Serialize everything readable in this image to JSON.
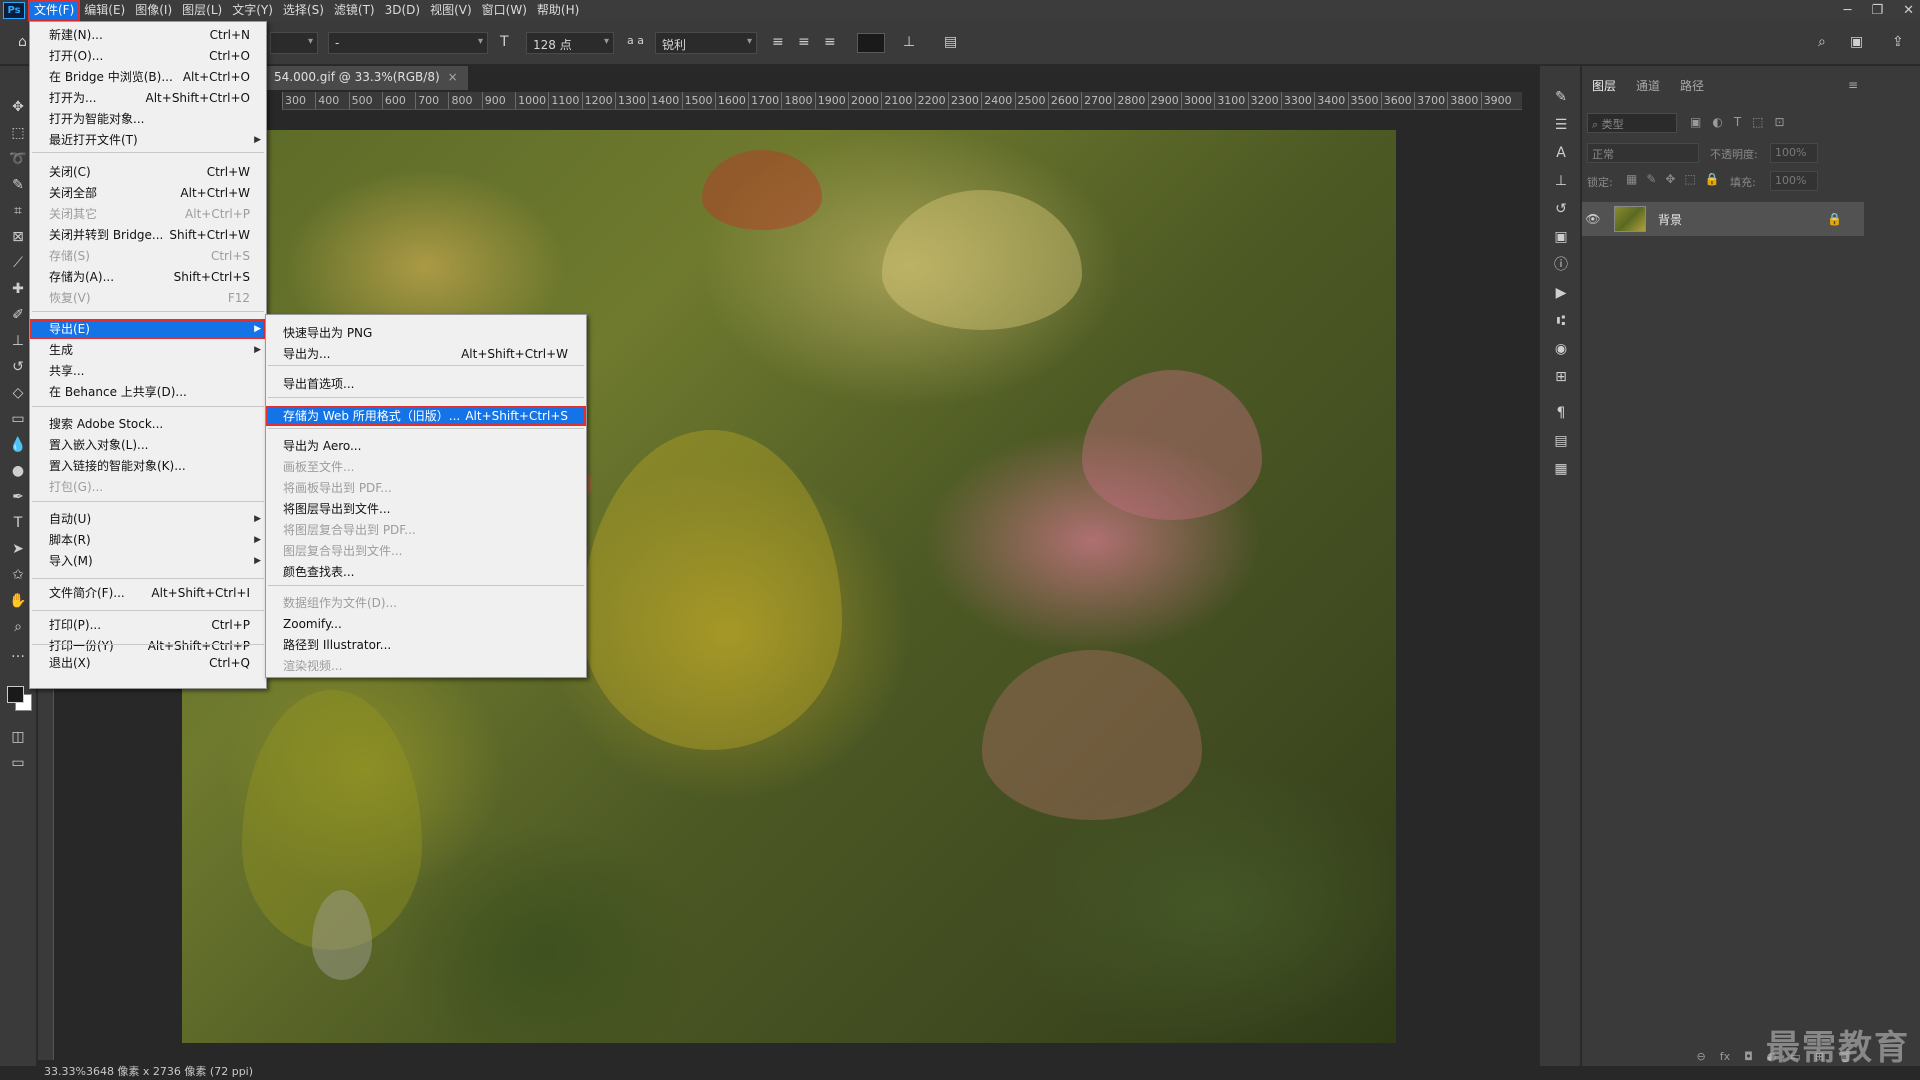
{
  "menubar": {
    "logo": "Ps",
    "items": [
      "文件(F)",
      "编辑(E)",
      "图像(I)",
      "图层(L)",
      "文字(Y)",
      "选择(S)",
      "滤镜(T)",
      "3D(D)",
      "视图(V)",
      "窗口(W)",
      "帮助(H)"
    ],
    "active_index": 0
  },
  "options": {
    "font_style": "-",
    "font_size": "128 点",
    "aa_label": "a a",
    "antialias": "锐利"
  },
  "document": {
    "tab_title": "54.000.gif @ 33.3%(RGB/8)",
    "ruler_ticks": [
      "300",
      "400",
      "500",
      "600",
      "700",
      "800",
      "900",
      "1000",
      "1100",
      "1200",
      "1300",
      "1400",
      "1500",
      "1600",
      "1700",
      "1800",
      "1900",
      "2000",
      "2100",
      "2200",
      "2300",
      "2400",
      "2500",
      "2600",
      "2700",
      "2800",
      "2900",
      "3000",
      "3100",
      "3200",
      "3300",
      "3400",
      "3500",
      "3600",
      "3700",
      "3800",
      "3900"
    ]
  },
  "status": {
    "text": "33.33%3648 像素 x 2736 像素 (72 ppi)"
  },
  "layers_panel": {
    "tabs": [
      "图层",
      "通道",
      "路径"
    ],
    "filter_placeholder": "类型",
    "blend_mode": "正常",
    "opacity_label": "不透明度:",
    "opacity_value": "100%",
    "lock_label": "锁定:",
    "fill_label": "填充:",
    "fill_value": "100%",
    "layer_name": "背景"
  },
  "file_menu": {
    "items": [
      {
        "label": "新建(N)...",
        "shortcut": "Ctrl+N"
      },
      {
        "label": "打开(O)...",
        "shortcut": "Ctrl+O"
      },
      {
        "label": "在 Bridge 中浏览(B)...",
        "shortcut": "Alt+Ctrl+O"
      },
      {
        "label": "打开为...",
        "shortcut": "Alt+Shift+Ctrl+O"
      },
      {
        "label": "打开为智能对象...",
        "shortcut": ""
      },
      {
        "label": "最近打开文件(T)",
        "shortcut": ""
      },
      {
        "label": "关闭(C)",
        "shortcut": "Ctrl+W"
      },
      {
        "label": "关闭全部",
        "shortcut": "Alt+Ctrl+W"
      },
      {
        "label": "关闭其它",
        "shortcut": "Alt+Ctrl+P"
      },
      {
        "label": "关闭并转到 Bridge...",
        "shortcut": "Shift+Ctrl+W"
      },
      {
        "label": "存储(S)",
        "shortcut": "Ctrl+S"
      },
      {
        "label": "存储为(A)...",
        "shortcut": "Shift+Ctrl+S"
      },
      {
        "label": "恢复(V)",
        "shortcut": "F12"
      },
      {
        "label": "导出(E)",
        "shortcut": ""
      },
      {
        "label": "生成",
        "shortcut": ""
      },
      {
        "label": "共享...",
        "shortcut": ""
      },
      {
        "label": "在 Behance 上共享(D)...",
        "shortcut": ""
      },
      {
        "label": "搜索 Adobe Stock...",
        "shortcut": ""
      },
      {
        "label": "置入嵌入对象(L)...",
        "shortcut": ""
      },
      {
        "label": "置入链接的智能对象(K)...",
        "shortcut": ""
      },
      {
        "label": "打包(G)...",
        "shortcut": ""
      },
      {
        "label": "自动(U)",
        "shortcut": ""
      },
      {
        "label": "脚本(R)",
        "shortcut": ""
      },
      {
        "label": "导入(M)",
        "shortcut": ""
      },
      {
        "label": "文件简介(F)...",
        "shortcut": "Alt+Shift+Ctrl+I"
      },
      {
        "label": "打印(P)...",
        "shortcut": "Ctrl+P"
      },
      {
        "label": "打印一份(Y)",
        "shortcut": "Alt+Shift+Ctrl+P"
      },
      {
        "label": "退出(X)",
        "shortcut": "Ctrl+Q"
      }
    ]
  },
  "export_menu": {
    "items": [
      {
        "label": "快速导出为 PNG",
        "shortcut": ""
      },
      {
        "label": "导出为...",
        "shortcut": "Alt+Shift+Ctrl+W"
      },
      {
        "label": "导出首选项...",
        "shortcut": ""
      },
      {
        "label": "存储为 Web 所用格式（旧版）...",
        "shortcut": "Alt+Shift+Ctrl+S"
      },
      {
        "label": "导出为 Aero...",
        "shortcut": ""
      },
      {
        "label": "画板至文件...",
        "shortcut": ""
      },
      {
        "label": "将画板导出到 PDF...",
        "shortcut": ""
      },
      {
        "label": "将图层导出到文件...",
        "shortcut": ""
      },
      {
        "label": "将图层复合导出到 PDF...",
        "shortcut": ""
      },
      {
        "label": "图层复合导出到文件...",
        "shortcut": ""
      },
      {
        "label": "颜色查找表...",
        "shortcut": ""
      },
      {
        "label": "数据组作为文件(D)...",
        "shortcut": ""
      },
      {
        "label": "Zoomify...",
        "shortcut": ""
      },
      {
        "label": "路径到 Illustrator...",
        "shortcut": ""
      },
      {
        "label": "渲染视频...",
        "shortcut": ""
      }
    ]
  },
  "watermark": "最需教育",
  "colors": {
    "accent": "#1473e6",
    "highlight_border": "#e03030"
  }
}
